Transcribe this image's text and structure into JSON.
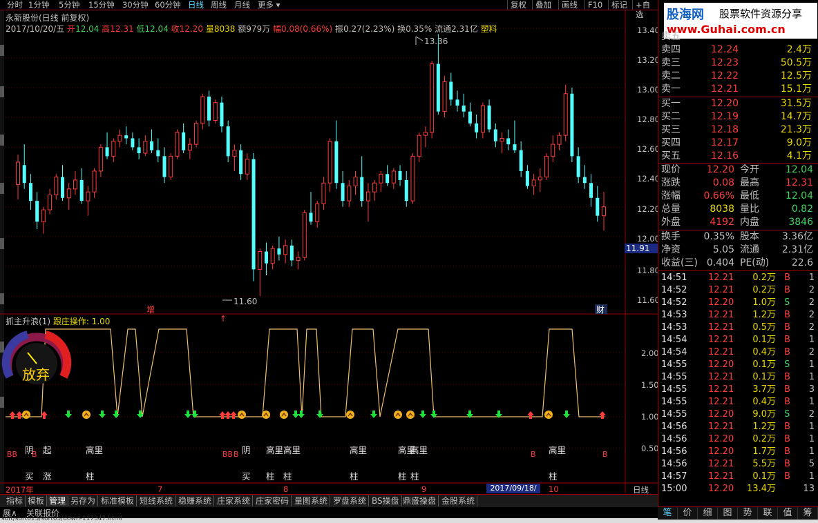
{
  "toolbar": {
    "periods": [
      "分时",
      "1分钟",
      "5分钟",
      "15分钟",
      "30分钟",
      "60分钟",
      "日线",
      "周线",
      "月线",
      "更多"
    ],
    "active_period": "日线",
    "buttons": [
      "复权",
      "叠加",
      "画线",
      "F10",
      "标记",
      "+自选"
    ],
    "more_arrow": "▾"
  },
  "stock": {
    "title": "永新股份(日线 前复权)",
    "date": "2017/10/20/五",
    "open_label": "开",
    "open": "12.04",
    "high_label": "高",
    "high": "12.31",
    "low_label": "低",
    "low": "12.04",
    "close_label": "收",
    "close": "12.20",
    "vol_label": "量",
    "vol": "8038",
    "amt_label": "额",
    "amt": "979万",
    "chg_label": "幅",
    "chg": "0.08(0.66%)",
    "amp_label": "振",
    "amp": "0.27(2.23%)",
    "turn_label": "换",
    "turn": "0.35%",
    "float_label": "流通",
    "float": "2.31亿",
    "sector": "塑料"
  },
  "price_axis": [
    "13.40",
    "13.20",
    "13.00",
    "12.80",
    "12.60",
    "12.40",
    "12.20",
    "12.00",
    "11.80",
    "11.60"
  ],
  "price_marker": "11.91",
  "max_label": "13.36",
  "min_label": "11.60",
  "zeng_tag": "增",
  "cai_tag": "财",
  "indicator": {
    "title": "抓主升浪(1)",
    "follow": "跟庄操作: 1.00",
    "axis": [
      "2.00",
      "1.50",
      "1.00",
      "0.50"
    ],
    "gauge_text": "放弃",
    "signals_top": [
      {
        "t": "阴"
      },
      {
        "t": "起"
      },
      {
        "t": "高里"
      },
      {
        "t": "阴"
      },
      {
        "t": "高里"
      },
      {
        "t": "高里"
      },
      {
        "t": "高里"
      },
      {
        "t": "高里"
      },
      {
        "t": "高里"
      },
      {
        "t": "高里"
      }
    ],
    "signals_bottom": [
      {
        "t": "买"
      },
      {
        "t": "涨"
      },
      {
        "t": "柱"
      },
      {
        "t": "买"
      },
      {
        "t": "柱"
      },
      {
        "t": "柱"
      },
      {
        "t": "柱"
      },
      {
        "t": "柱"
      },
      {
        "t": "柱"
      },
      {
        "t": "柱"
      }
    ],
    "bb_left": "BB",
    "b_left": "B",
    "bb_mid": "BB",
    "b_mid": "B",
    "b_r1": "B",
    "b_r2": "B"
  },
  "date_axis": {
    "year": "2017年",
    "m7": "7",
    "m8": "8",
    "m9": "9",
    "m10": "10",
    "cursor": "2017/09/18/—",
    "period": "日线"
  },
  "bottom_tabs": [
    "指标",
    "模板",
    "管理",
    "另存为",
    "标准模板",
    "短线系统",
    "稳赚系统",
    "庄家系统",
    "庄家密码",
    "量图系统",
    "罗盘系统",
    "BS操盘",
    "鼎盛操盘",
    "金股系统"
  ],
  "active_tab": "管理",
  "bottom_links": [
    "展∧",
    "关联报价"
  ],
  "status_url": "soft/sort013/sort05/down-117347.html",
  "brand": {
    "name": "股海网",
    "slogan": "股票软件资源分享",
    "url": "www.Guhai.com.cn"
  },
  "order_book": {
    "sells": [
      {
        "label": "卖五",
        "price": "",
        "vol": ""
      },
      {
        "label": "卖四",
        "price": "12.24",
        "vol": "2.4万"
      },
      {
        "label": "卖三",
        "price": "12.23",
        "vol": "50.5万"
      },
      {
        "label": "卖二",
        "price": "12.22",
        "vol": "12.5万"
      },
      {
        "label": "卖一",
        "price": "12.21",
        "vol": "15.1万"
      }
    ],
    "buys": [
      {
        "label": "买一",
        "price": "12.20",
        "vol": "31.5万"
      },
      {
        "label": "买二",
        "price": "12.19",
        "vol": "14.7万"
      },
      {
        "label": "买三",
        "price": "12.18",
        "vol": "21.3万"
      },
      {
        "label": "买四",
        "price": "12.17",
        "vol": "9.0万"
      },
      {
        "label": "买五",
        "price": "12.16",
        "vol": "4.1万"
      }
    ]
  },
  "quote": [
    {
      "l1": "现价",
      "v1": "12.20",
      "l2": "今开",
      "v2": "12.04",
      "c1": "up",
      "c2": "dn"
    },
    {
      "l1": "涨跌",
      "v1": "0.08",
      "l2": "最高",
      "v2": "12.31",
      "c1": "up",
      "c2": "up"
    },
    {
      "l1": "涨幅",
      "v1": "0.66%",
      "l2": "最低",
      "v2": "12.04",
      "c1": "up",
      "c2": "dn"
    },
    {
      "l1": "总量",
      "v1": "8038",
      "l2": "量比",
      "v2": "0.82",
      "c1": "yel",
      "c2": "dn"
    },
    {
      "l1": "外盘",
      "v1": "4192",
      "l2": "内盘",
      "v2": "3846",
      "c1": "up",
      "c2": "dn"
    }
  ],
  "fundamentals": [
    {
      "l1": "换手",
      "v1": "0.35%",
      "l2": "股本",
      "v2": "3.36亿"
    },
    {
      "l1": "净资",
      "v1": "5.05",
      "l2": "流通",
      "v2": "2.31亿"
    },
    {
      "l1": "收益(三)",
      "v1": "0.404",
      "l2": "PE(动)",
      "v2": "22.6"
    }
  ],
  "ticks": [
    {
      "t": "14:51",
      "p": "12.21",
      "v": "0.2万",
      "s": "B",
      "n": "1"
    },
    {
      "t": "14:52",
      "p": "12.21",
      "v": "0.2万",
      "s": "B",
      "n": "2"
    },
    {
      "t": "14:52",
      "p": "12.20",
      "v": "1.0万",
      "s": "S",
      "n": "2"
    },
    {
      "t": "14:53",
      "p": "12.21",
      "v": "1.2万",
      "s": "B",
      "n": "2"
    },
    {
      "t": "14:53",
      "p": "12.21",
      "v": "0.5万",
      "s": "B",
      "n": "2"
    },
    {
      "t": "14:54",
      "p": "12.21",
      "v": "0.1万",
      "s": "B",
      "n": "1"
    },
    {
      "t": "14:54",
      "p": "12.21",
      "v": "0.4万",
      "s": "B",
      "n": "2"
    },
    {
      "t": "14:55",
      "p": "12.20",
      "v": "0.1万",
      "s": "S",
      "n": "1"
    },
    {
      "t": "14:55",
      "p": "12.21",
      "v": "0.1万",
      "s": "B",
      "n": "1"
    },
    {
      "t": "14:55",
      "p": "12.21",
      "v": "3.7万",
      "s": "B",
      "n": "3"
    },
    {
      "t": "14:55",
      "p": "12.21",
      "v": "0.4万",
      "s": "B",
      "n": "1"
    },
    {
      "t": "14:55",
      "p": "12.20",
      "v": "9.0万",
      "s": "S",
      "n": "2"
    },
    {
      "t": "14:56",
      "p": "12.21",
      "v": "1.2万",
      "s": "B",
      "n": "1"
    },
    {
      "t": "14:56",
      "p": "12.20",
      "v": "0.2万",
      "s": "B",
      "n": "1"
    },
    {
      "t": "14:56",
      "p": "12.20",
      "v": "1.7万",
      "s": "B",
      "n": "1"
    },
    {
      "t": "14:56",
      "p": "12.21",
      "v": "5.5万",
      "s": "B",
      "n": "5"
    },
    {
      "t": "14:57",
      "p": "12.21",
      "v": "0.1万",
      "s": "B",
      "n": "1"
    },
    {
      "t": "15:00",
      "p": "12.20",
      "v": "13.4万",
      "s": "",
      "n": "13"
    }
  ],
  "right_buttons": [
    "笔",
    "价",
    "细",
    "图",
    "势",
    "联",
    "值",
    "筹"
  ],
  "chart_data": {
    "type": "candlestick",
    "ylim": [
      11.55,
      13.45
    ],
    "candles": [
      [
        12.35,
        12.55,
        12.25,
        12.5
      ],
      [
        12.48,
        12.62,
        12.32,
        12.36
      ],
      [
        12.36,
        12.42,
        12.18,
        12.24
      ],
      [
        12.24,
        12.3,
        12.05,
        12.1
      ],
      [
        12.1,
        12.2,
        12.02,
        12.18
      ],
      [
        12.18,
        12.32,
        12.15,
        12.28
      ],
      [
        12.28,
        12.42,
        12.25,
        12.4
      ],
      [
        12.4,
        12.48,
        12.24,
        12.26
      ],
      [
        12.26,
        12.36,
        12.18,
        12.32
      ],
      [
        12.32,
        12.44,
        12.28,
        12.38
      ],
      [
        12.38,
        12.46,
        12.22,
        12.24
      ],
      [
        12.24,
        12.34,
        12.14,
        12.3
      ],
      [
        12.3,
        12.46,
        12.26,
        12.44
      ],
      [
        12.44,
        12.62,
        12.4,
        12.6
      ],
      [
        12.6,
        12.7,
        12.52,
        12.54
      ],
      [
        12.54,
        12.66,
        12.5,
        12.64
      ],
      [
        12.64,
        12.72,
        12.6,
        12.68
      ],
      [
        12.68,
        12.74,
        12.62,
        12.66
      ],
      [
        12.66,
        12.7,
        12.58,
        12.6
      ],
      [
        12.6,
        12.66,
        12.52,
        12.56
      ],
      [
        12.56,
        12.68,
        12.54,
        12.64
      ],
      [
        12.64,
        12.72,
        12.56,
        12.58
      ],
      [
        12.58,
        12.66,
        12.5,
        12.54
      ],
      [
        12.54,
        12.6,
        12.36,
        12.4
      ],
      [
        12.4,
        12.56,
        12.38,
        12.54
      ],
      [
        12.54,
        12.72,
        12.52,
        12.7
      ],
      [
        12.7,
        12.76,
        12.56,
        12.58
      ],
      [
        12.58,
        12.66,
        12.52,
        12.62
      ],
      [
        12.62,
        12.78,
        12.6,
        12.76
      ],
      [
        12.76,
        12.96,
        12.72,
        12.94
      ],
      [
        12.94,
        12.98,
        12.74,
        12.78
      ],
      [
        12.78,
        12.92,
        12.76,
        12.9
      ],
      [
        12.9,
        12.94,
        12.7,
        12.74
      ],
      [
        12.74,
        12.78,
        12.5,
        12.54
      ],
      [
        12.54,
        12.62,
        12.44,
        12.58
      ],
      [
        12.58,
        12.62,
        12.38,
        12.42
      ],
      [
        12.42,
        12.56,
        12.38,
        12.52
      ],
      [
        12.52,
        12.56,
        11.7,
        11.78
      ],
      [
        11.78,
        11.92,
        11.6,
        11.9
      ],
      [
        11.9,
        11.96,
        11.74,
        11.82
      ],
      [
        11.82,
        11.94,
        11.78,
        11.92
      ],
      [
        11.92,
        12.0,
        11.84,
        11.88
      ],
      [
        11.88,
        11.98,
        11.82,
        11.94
      ],
      [
        11.94,
        11.98,
        11.8,
        11.84
      ],
      [
        11.84,
        11.9,
        11.78,
        11.86
      ],
      [
        11.86,
        12.18,
        11.84,
        12.16
      ],
      [
        12.16,
        12.3,
        12.08,
        12.1
      ],
      [
        12.1,
        12.24,
        12.06,
        12.22
      ],
      [
        12.22,
        12.4,
        12.18,
        12.36
      ],
      [
        12.36,
        12.66,
        12.3,
        12.64
      ],
      [
        12.64,
        12.78,
        12.32,
        12.36
      ],
      [
        12.36,
        12.44,
        12.2,
        12.24
      ],
      [
        12.24,
        12.38,
        12.2,
        12.34
      ],
      [
        12.34,
        12.44,
        12.28,
        12.4
      ],
      [
        12.4,
        12.54,
        12.2,
        12.24
      ],
      [
        12.24,
        12.36,
        12.1,
        12.3
      ],
      [
        12.3,
        12.38,
        12.24,
        12.36
      ],
      [
        12.36,
        12.44,
        12.3,
        12.42
      ],
      [
        12.42,
        12.48,
        12.34,
        12.36
      ],
      [
        12.36,
        12.46,
        12.32,
        12.44
      ],
      [
        12.44,
        12.48,
        12.34,
        12.38
      ],
      [
        12.38,
        12.44,
        12.2,
        12.24
      ],
      [
        12.24,
        12.56,
        12.22,
        12.54
      ],
      [
        12.54,
        12.7,
        12.5,
        12.68
      ],
      [
        12.68,
        12.74,
        12.6,
        12.7
      ],
      [
        12.7,
        13.18,
        12.66,
        13.16
      ],
      [
        13.16,
        13.36,
        12.82,
        12.84
      ],
      [
        12.84,
        13.08,
        12.8,
        13.04
      ],
      [
        13.04,
        13.1,
        12.88,
        12.92
      ],
      [
        12.92,
        12.98,
        12.84,
        12.88
      ],
      [
        12.88,
        12.96,
        12.8,
        12.84
      ],
      [
        12.84,
        12.9,
        12.74,
        12.76
      ],
      [
        12.76,
        12.82,
        12.66,
        12.7
      ],
      [
        12.7,
        12.9,
        12.66,
        12.88
      ],
      [
        12.88,
        12.92,
        12.7,
        12.72
      ],
      [
        12.72,
        12.76,
        12.6,
        12.64
      ],
      [
        12.64,
        12.7,
        12.56,
        12.66
      ],
      [
        12.66,
        12.72,
        12.58,
        12.62
      ],
      [
        12.62,
        12.78,
        12.56,
        12.58
      ],
      [
        12.58,
        12.64,
        12.4,
        12.44
      ],
      [
        12.44,
        12.48,
        12.32,
        12.34
      ],
      [
        12.34,
        12.42,
        12.28,
        12.38
      ],
      [
        12.38,
        12.46,
        12.3,
        12.4
      ],
      [
        12.4,
        12.56,
        12.38,
        12.54
      ],
      [
        12.54,
        12.68,
        12.5,
        12.62
      ],
      [
        12.62,
        12.7,
        12.58,
        12.68
      ],
      [
        12.68,
        13.02,
        12.64,
        12.96
      ],
      [
        12.96,
        13.0,
        12.5,
        12.54
      ],
      [
        12.54,
        12.6,
        12.36,
        12.4
      ],
      [
        12.4,
        12.48,
        12.32,
        12.36
      ],
      [
        12.36,
        12.42,
        12.2,
        12.26
      ],
      [
        12.26,
        12.34,
        12.1,
        12.14
      ],
      [
        12.14,
        12.3,
        12.04,
        12.2
      ]
    ]
  }
}
